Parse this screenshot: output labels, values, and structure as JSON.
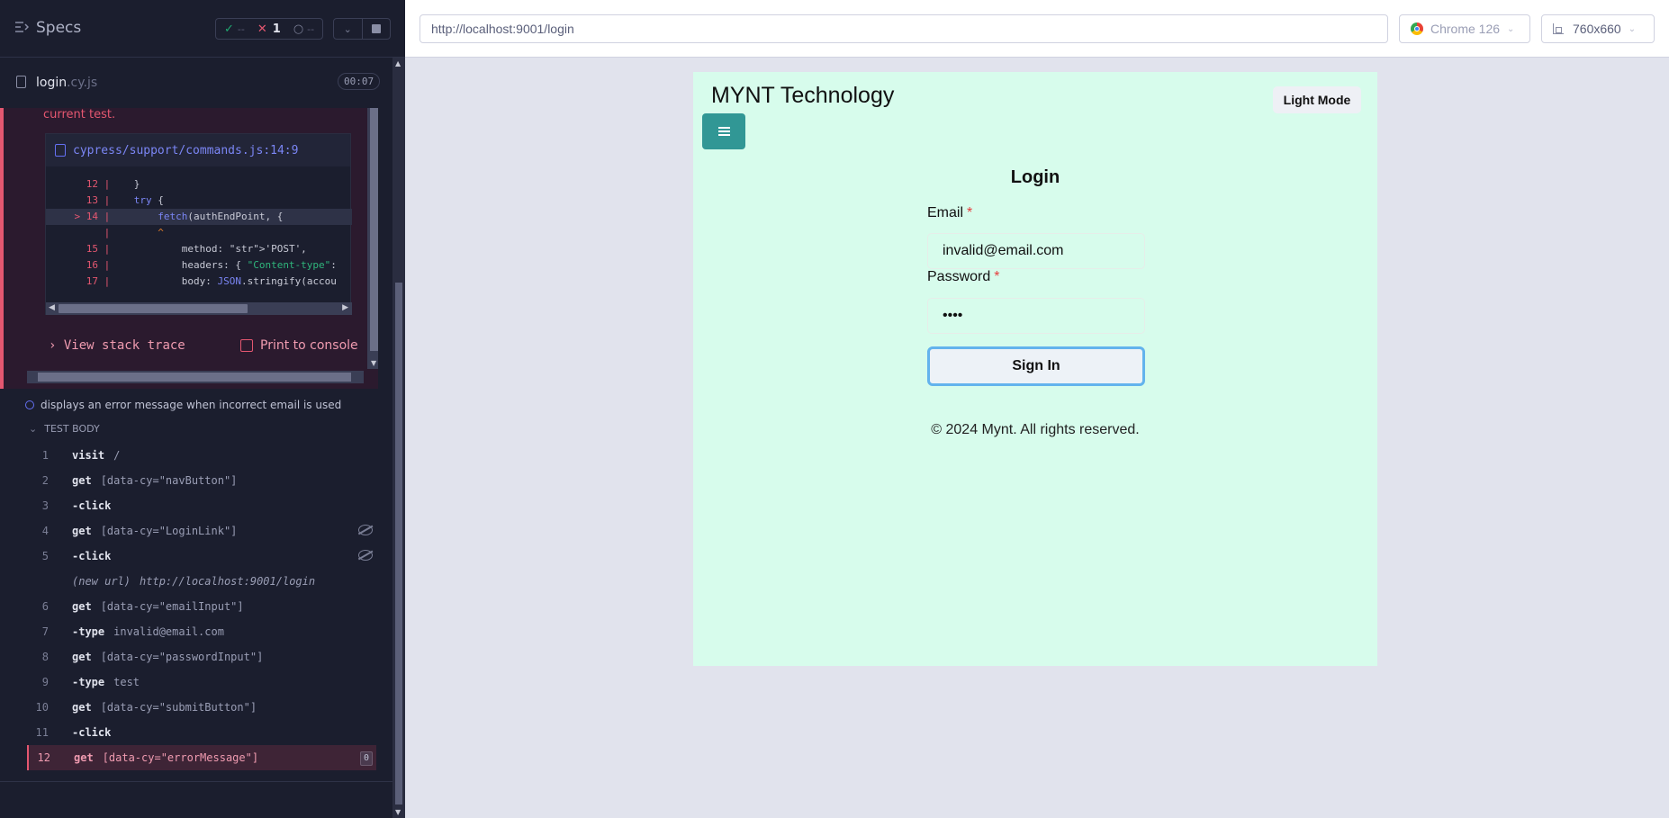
{
  "runner": {
    "specs_title": "Specs",
    "stats": {
      "passed": "--",
      "failed": "1",
      "pending": "--"
    },
    "file": {
      "name": "login",
      "ext": ".cy.js",
      "time": "00:07"
    },
    "error": {
      "tail_text": "current test.",
      "frame_path": "cypress/support/commands.js:14:9",
      "code_lines": [
        {
          "ln": "12",
          "code": "    }"
        },
        {
          "ln": "13",
          "code": "    try {"
        },
        {
          "ln": "> 14",
          "code": "        fetch(authEndPoint, {"
        },
        {
          "ln": "",
          "code": "        ^"
        },
        {
          "ln": "15",
          "code": "            method: 'POST',"
        },
        {
          "ln": "16",
          "code": "            headers: { \"Content-type\":"
        },
        {
          "ln": "17",
          "code": "            body: JSON.stringify(accou"
        }
      ],
      "view_stack_label": "View stack trace",
      "print_console_label": "Print to console"
    },
    "test_title": "displays an error message when incorrect email is used",
    "test_body_label": "TEST BODY",
    "commands": [
      {
        "num": "1",
        "name": "visit",
        "arg": "/",
        "child": false
      },
      {
        "num": "2",
        "name": "get",
        "arg": "[data-cy=\"navButton\"]",
        "child": false
      },
      {
        "num": "3",
        "name": "-click",
        "arg": "",
        "child": true
      },
      {
        "num": "4",
        "name": "get",
        "arg": "[data-cy=\"LoginLink\"]",
        "child": false,
        "hidden_icon": true
      },
      {
        "num": "5",
        "name": "-click",
        "arg": "",
        "child": true,
        "hidden_icon": true
      },
      {
        "num": "",
        "name": "(new url)",
        "arg": "http://localhost:9001/login",
        "child": false,
        "url": true
      },
      {
        "num": "6",
        "name": "get",
        "arg": "[data-cy=\"emailInput\"]",
        "child": false
      },
      {
        "num": "7",
        "name": "-type",
        "arg": "invalid@email.com",
        "child": true
      },
      {
        "num": "8",
        "name": "get",
        "arg": "[data-cy=\"passwordInput\"]",
        "child": false
      },
      {
        "num": "9",
        "name": "-type",
        "arg": "test",
        "child": true
      },
      {
        "num": "10",
        "name": "get",
        "arg": "[data-cy=\"submitButton\"]",
        "child": false
      },
      {
        "num": "11",
        "name": "-click",
        "arg": "",
        "child": true
      },
      {
        "num": "12",
        "name": "get",
        "arg": "[data-cy=\"errorMessage\"]",
        "child": false,
        "failed": true,
        "badge": "0"
      }
    ]
  },
  "browser": {
    "url": "http://localhost:9001/login",
    "browser_name": "Chrome 126",
    "viewport": "760x660"
  },
  "app": {
    "title": "MYNT Technology",
    "light_mode_label": "Light Mode",
    "login_heading": "Login",
    "email_label": "Email",
    "email_value": "invalid@email.com",
    "password_label": "Password",
    "password_value": "••••",
    "required_mark": "*",
    "signin_label": "Sign In",
    "copyright": "© 2024 Mynt. All rights reserved.",
    "colors": {
      "background": "#d7fcec",
      "nav_button": "#319795",
      "signin_focus": "#63b3ed"
    }
  }
}
